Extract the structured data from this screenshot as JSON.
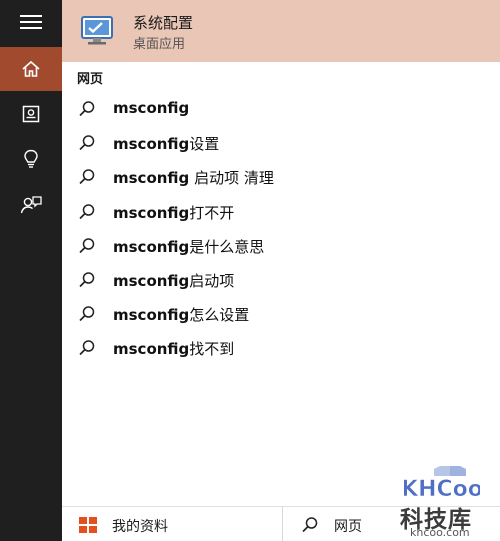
{
  "sidebar": {
    "items": [
      {
        "name": "menu",
        "icon": "hamburger-menu-icon"
      },
      {
        "name": "home",
        "icon": "home-icon",
        "active": true
      },
      {
        "name": "notebook",
        "icon": "notebook-icon"
      },
      {
        "name": "reminders",
        "icon": "lightbulb-icon"
      },
      {
        "name": "feedback",
        "icon": "feedback-icon"
      }
    ],
    "background": "#1f1f1f",
    "active_color": "#a14a2e"
  },
  "best_match": {
    "title": "系统配置",
    "subtitle": "桌面应用",
    "icon": "system-configuration-icon",
    "background": "#e9c6b5"
  },
  "web_section": {
    "label": "网页"
  },
  "results": [
    {
      "bold": "msconfig",
      "rest": ""
    },
    {
      "bold": "msconfig",
      "rest": "设置"
    },
    {
      "bold": "msconfig",
      "rest": " 启动项 清理"
    },
    {
      "bold": "msconfig",
      "rest": "打不开"
    },
    {
      "bold": "msconfig",
      "rest": "是什么意思"
    },
    {
      "bold": "msconfig",
      "rest": "启动项"
    },
    {
      "bold": "msconfig",
      "rest": "怎么设置"
    },
    {
      "bold": "msconfig",
      "rest": "找不到"
    }
  ],
  "footer": {
    "my_stuff_label": "我的资料",
    "web_label": "网页",
    "windows_logo_color": "#e3501e"
  },
  "watermark": {
    "logo_text": "KHCoo",
    "chinese_text": "科技库",
    "url": "khcoo.com"
  }
}
